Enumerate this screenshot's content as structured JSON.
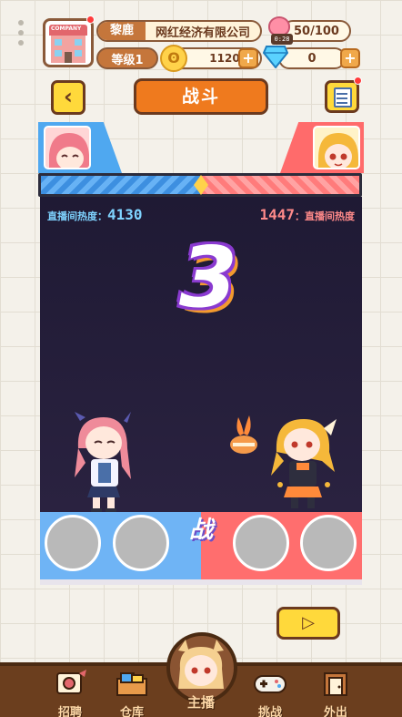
{
  "header": {
    "company_icon_text": "COMPANY",
    "player_name": "黎鹿",
    "company_name": "网红经济有限公司",
    "level": "等级1",
    "coins": "1120",
    "energy": "50/100",
    "energy_timer": "0:28",
    "gems": "0"
  },
  "title": {
    "back_glyph": "‹",
    "text": "战斗"
  },
  "battle": {
    "left_heat_label": "直播间热度：",
    "left_heat_value": "4130",
    "right_heat_value": "1447",
    "right_heat_label": "：直播间热度",
    "countdown": "3",
    "skill_label": "战"
  },
  "play_glyph": "▷",
  "nav": {
    "items": [
      {
        "label": "招聘",
        "icon": "recruit-icon"
      },
      {
        "label": "仓库",
        "icon": "warehouse-icon"
      },
      {
        "label": "主播",
        "icon": "streamer-icon"
      },
      {
        "label": "挑战",
        "icon": "gamepad-icon"
      },
      {
        "label": "外出",
        "icon": "outing-icon"
      }
    ]
  },
  "colors": {
    "accent_orange": "#ef7a1e",
    "player_blue": "#4fa8f0",
    "enemy_red": "#ff6b6b",
    "nav_brown": "#6b3e1e"
  }
}
